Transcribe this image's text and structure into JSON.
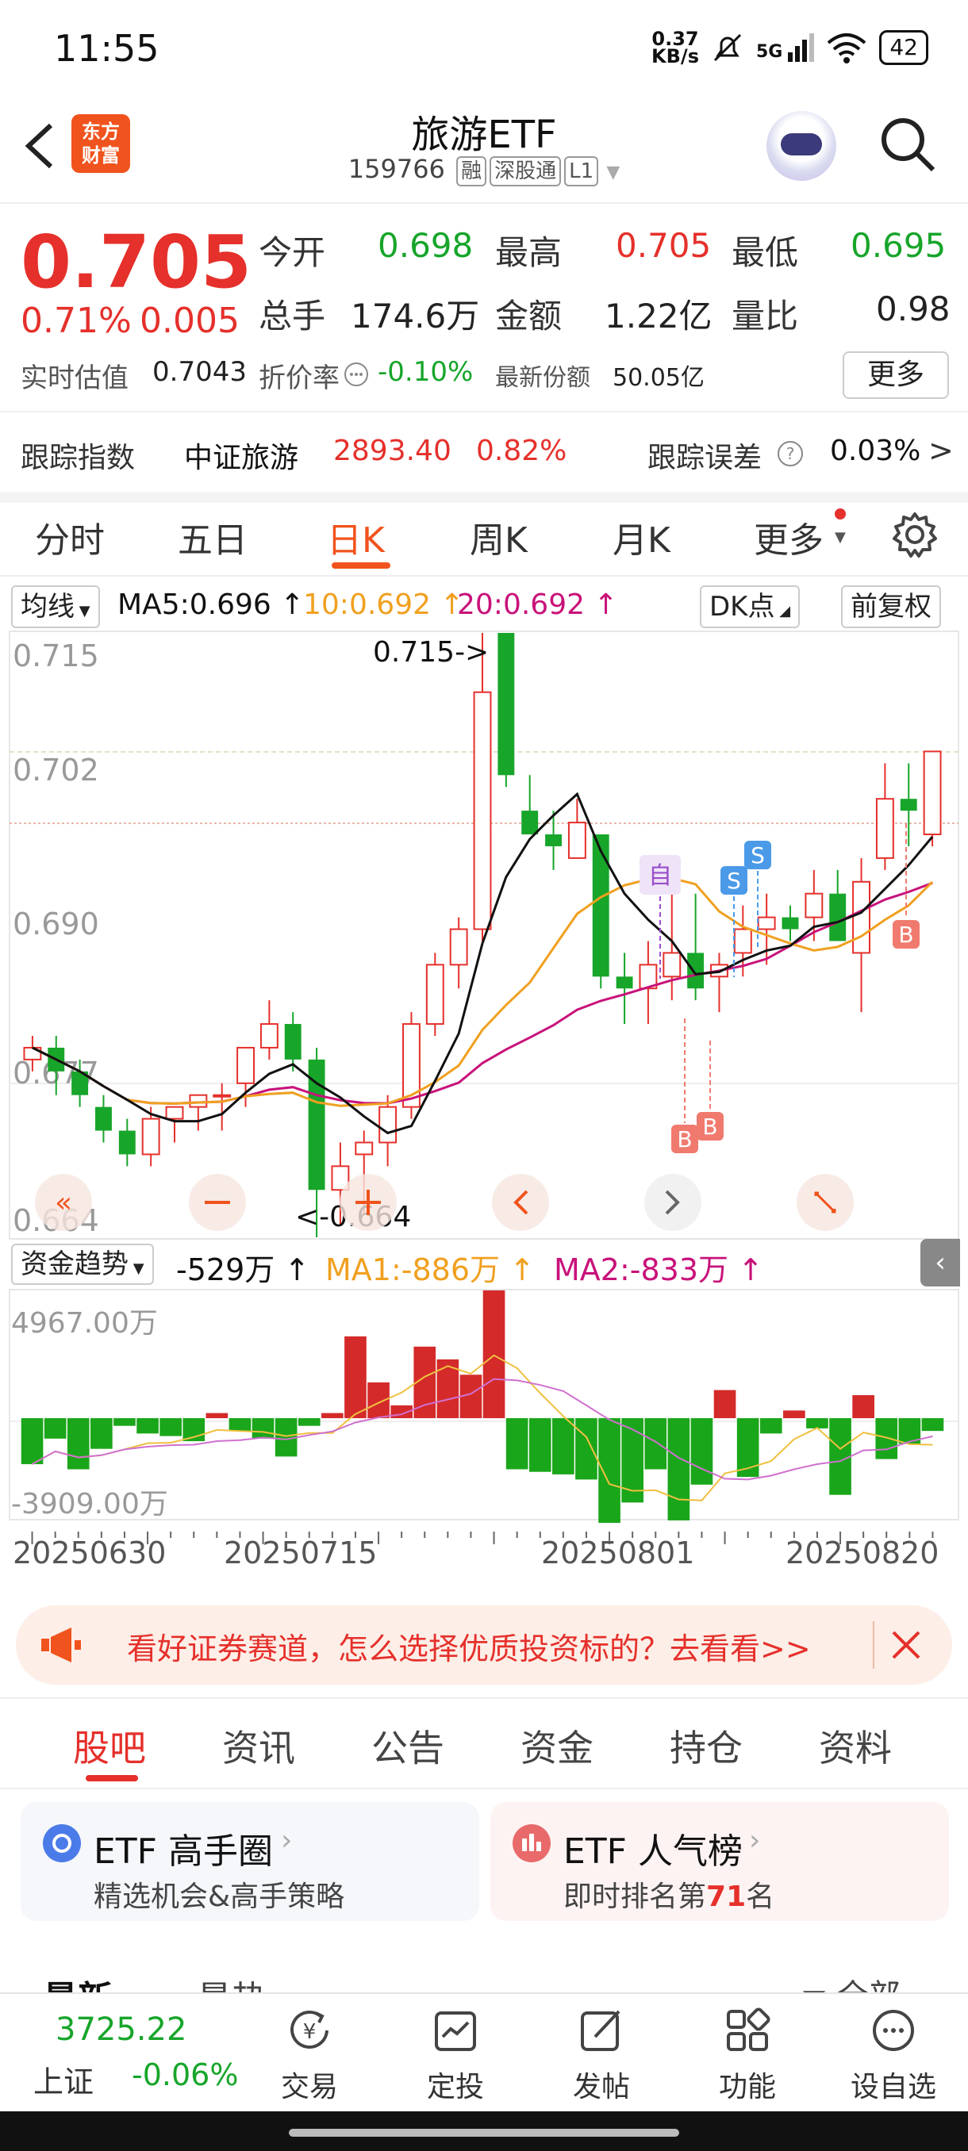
{
  "status": {
    "time": "11:55",
    "net_speed_top": "0.37",
    "net_speed_bottom": "KB/s",
    "signal": "5G",
    "battery": "42"
  },
  "header": {
    "logo_line1": "东方",
    "logo_line2": "财富",
    "title": "旅游ETF",
    "code": "159766",
    "tags": [
      "融",
      "深股通",
      "L1"
    ]
  },
  "quote": {
    "price": "0.705",
    "change_pct": "0.71%",
    "change": "0.005",
    "open_label": "今开",
    "open": "0.698",
    "high_label": "最高",
    "high": "0.705",
    "low_label": "最低",
    "low": "0.695",
    "volume_label": "总手",
    "volume": "174.6万",
    "amount_label": "金额",
    "amount": "1.22亿",
    "ratio_label": "量比",
    "ratio": "0.98",
    "iopv_label": "实时估值",
    "iopv": "0.7043",
    "discount_label": "折价率",
    "discount": "-0.10%",
    "shares_label": "最新份额",
    "shares": "50.05亿",
    "more": "更多"
  },
  "tracking": {
    "label": "跟踪指数",
    "index_name": "中证旅游",
    "index_value": "2893.40",
    "index_pct": "0.82%",
    "error_label": "跟踪误差",
    "error_value": "0.03%"
  },
  "chart_tabs": [
    "分时",
    "五日",
    "日K",
    "周K",
    "月K",
    "更多"
  ],
  "active_tab": "日K",
  "ma_row": {
    "selector": "均线",
    "ma5": "MA5:0.696",
    "ma10": "10:0.692",
    "ma20": "20:0.692",
    "dk": "DK点",
    "fq": "前复权"
  },
  "chart_labels": {
    "y1": "0.715",
    "y2": "0.702",
    "y3": "0.690",
    "y4": "0.677",
    "y5": "0.664",
    "high_mark": "0.715",
    "low_mark": "0.664",
    "self_mark": "自",
    "s_mark": "S",
    "b_mark": "B"
  },
  "fund_row": {
    "selector": "资金趋势",
    "value": "-529万",
    "ma1": "MA1:-886万",
    "ma2": "MA2:-833万",
    "top": "4967.00万",
    "bottom": "-3909.00万"
  },
  "dates": [
    "20250630",
    "20250715",
    "20250801",
    "20250820"
  ],
  "banner": {
    "text": "看好证券赛道，怎么选择优质投资标的？去看看>>"
  },
  "sub_tabs": [
    "股吧",
    "资讯",
    "公告",
    "资金",
    "持仓",
    "资料"
  ],
  "cards": [
    {
      "title": "ETF 高手圈",
      "sub": "精选机会&高手策略"
    },
    {
      "title": "ETF 人气榜",
      "sub_pre": "即时排名第",
      "rank": "71",
      "sub_post": "名"
    }
  ],
  "feed_tabs": {
    "latest": "最新",
    "hot": "最热",
    "all": "全部"
  },
  "bottom_nav": {
    "index_value": "3725.22",
    "index_name": "上证",
    "index_pct": "-0.06%",
    "items": [
      "交易",
      "定投",
      "发帖",
      "功能",
      "设自选"
    ]
  },
  "chart_data": [
    {
      "type": "candlestick",
      "title": "",
      "ylim": [
        0.664,
        0.715
      ],
      "x": [
        "20250630",
        "20250715",
        "20250801",
        "20250820"
      ],
      "candles_ohlc_approx": [
        [
          0.679,
          0.681,
          0.678,
          0.68
        ],
        [
          0.68,
          0.681,
          0.676,
          0.678
        ],
        [
          0.678,
          0.679,
          0.675,
          0.676
        ],
        [
          0.675,
          0.676,
          0.672,
          0.673
        ],
        [
          0.673,
          0.674,
          0.67,
          0.671
        ],
        [
          0.671,
          0.675,
          0.67,
          0.674
        ],
        [
          0.674,
          0.675,
          0.672,
          0.675
        ],
        [
          0.675,
          0.676,
          0.673,
          0.676
        ],
        [
          0.676,
          0.677,
          0.673,
          0.676
        ],
        [
          0.677,
          0.68,
          0.675,
          0.68
        ],
        [
          0.68,
          0.684,
          0.679,
          0.682
        ],
        [
          0.682,
          0.683,
          0.678,
          0.679
        ],
        [
          0.679,
          0.68,
          0.664,
          0.668
        ],
        [
          0.668,
          0.672,
          0.665,
          0.67
        ],
        [
          0.671,
          0.673,
          0.666,
          0.672
        ],
        [
          0.672,
          0.676,
          0.67,
          0.675
        ],
        [
          0.675,
          0.683,
          0.674,
          0.682
        ],
        [
          0.682,
          0.688,
          0.681,
          0.687
        ],
        [
          0.687,
          0.691,
          0.685,
          0.69
        ],
        [
          0.69,
          0.715,
          0.689,
          0.71
        ],
        [
          0.715,
          0.715,
          0.702,
          0.703
        ],
        [
          0.7,
          0.703,
          0.698,
          0.698
        ],
        [
          0.698,
          0.7,
          0.695,
          0.697
        ],
        [
          0.696,
          0.701,
          0.696,
          0.699
        ],
        [
          0.698,
          0.698,
          0.685,
          0.686
        ],
        [
          0.686,
          0.688,
          0.682,
          0.685
        ],
        [
          0.685,
          0.689,
          0.682,
          0.687
        ],
        [
          0.686,
          0.693,
          0.684,
          0.688
        ],
        [
          0.688,
          0.693,
          0.684,
          0.685
        ],
        [
          0.686,
          0.688,
          0.683,
          0.687
        ],
        [
          0.688,
          0.692,
          0.686,
          0.69
        ],
        [
          0.69,
          0.693,
          0.687,
          0.691
        ],
        [
          0.691,
          0.692,
          0.689,
          0.69
        ],
        [
          0.691,
          0.695,
          0.689,
          0.693
        ],
        [
          0.693,
          0.695,
          0.689,
          0.689
        ],
        [
          0.688,
          0.696,
          0.683,
          0.694
        ],
        [
          0.696,
          0.704,
          0.695,
          0.701
        ],
        [
          0.701,
          0.704,
          0.697,
          0.7
        ],
        [
          0.698,
          0.705,
          0.697,
          0.705
        ]
      ],
      "series": [
        {
          "name": "MA5",
          "values_end": 0.696
        },
        {
          "name": "MA10",
          "values_end": 0.692
        },
        {
          "name": "MA20",
          "values_end": 0.692
        }
      ]
    },
    {
      "type": "bar",
      "ylim": [
        -3909,
        4967
      ],
      "values": [
        -1800,
        -800,
        -2000,
        -1200,
        -300,
        -600,
        -700,
        -900,
        200,
        -500,
        -800,
        -1500,
        -300,
        200,
        3200,
        1400,
        500,
        2800,
        2300,
        1700,
        5000,
        -2000,
        -2100,
        -2200,
        -2400,
        -4200,
        -3300,
        -2000,
        -4000,
        -2600,
        1100,
        -2300,
        -600,
        300,
        -400,
        -3000,
        900,
        -1600,
        -1000,
        -500
      ]
    }
  ]
}
